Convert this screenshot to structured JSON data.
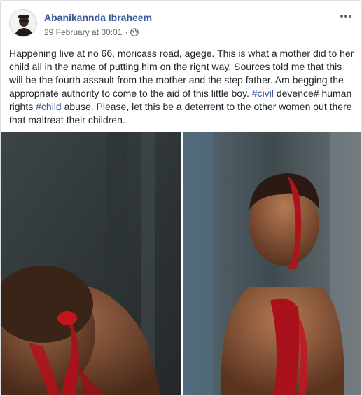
{
  "post": {
    "author": "Abanikannda Ibraheem",
    "date": "29 February at 00:01",
    "separator": "·",
    "privacy_icon": "globe-icon",
    "more_icon": "more-options-icon",
    "text": {
      "part1": "Happening live at no 66, moricass road, agege. This is what a mother did to her child all in the name of putting him on the right way. Sources told me that this will be the fourth assault from the mother and the step father. Am begging the appropriate authority to come to the aid of this little boy. ",
      "hashtag1": "#civil",
      "part2": " devence# human rights ",
      "hashtag2": "#child",
      "part3": " abuse. Please, let this be a deterrent to the other women out there that maltreat their children."
    }
  },
  "colors": {
    "link": "#385898",
    "text": "#1d2129",
    "meta": "#616770",
    "blood": "#b0121a"
  }
}
